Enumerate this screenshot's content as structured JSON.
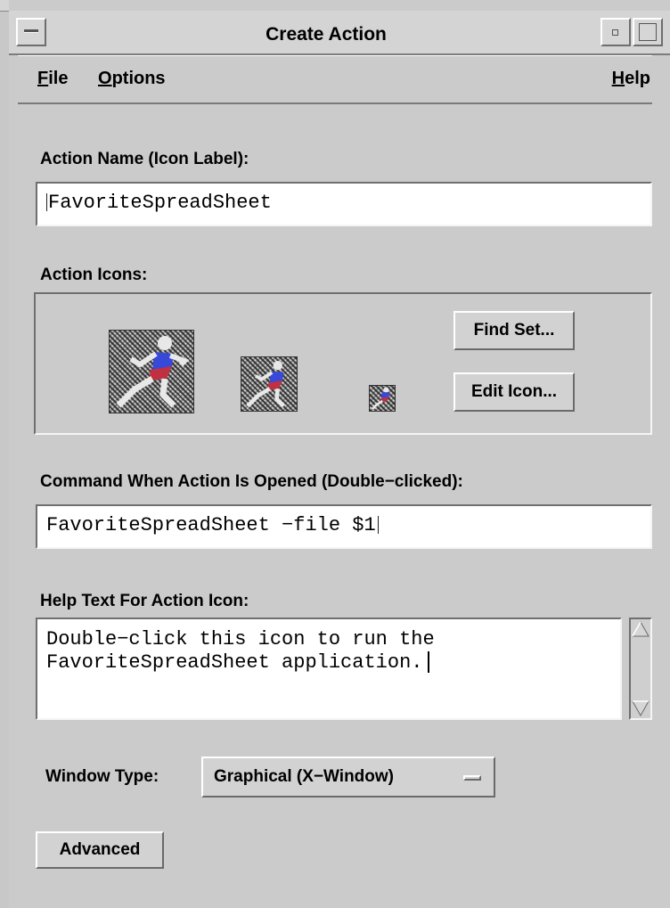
{
  "window": {
    "title": "Create Action"
  },
  "menubar": {
    "file": {
      "mnemonic": "F",
      "rest": "ile"
    },
    "options": {
      "mnemonic": "O",
      "rest": "ptions"
    },
    "help": {
      "mnemonic": "H",
      "rest": "elp"
    }
  },
  "action_name": {
    "label": "Action Name (Icon Label):",
    "value": "FavoriteSpreadSheet"
  },
  "action_icons": {
    "label": "Action Icons:",
    "find_set_button": "Find Set...",
    "edit_icon_button": "Edit Icon..."
  },
  "command": {
    "label": "Command When Action Is Opened (Double−clicked):",
    "value": "FavoriteSpreadSheet −file $1"
  },
  "help_text": {
    "label": "Help Text For Action Icon:",
    "line1": "Double−click this icon to run the",
    "line2": "FavoriteSpreadSheet application."
  },
  "window_type": {
    "label": "Window Type:",
    "selected": "Graphical (X−Window)"
  },
  "advanced_button": "Advanced",
  "colors": {
    "runner_shirt": "#3848d8",
    "runner_shorts": "#c03040",
    "runner_skin": "#e8e8e8"
  },
  "icons": [
    "window-menu-icon",
    "minimize-icon",
    "maximize-icon",
    "runner-icon-large",
    "runner-icon-medium",
    "runner-icon-small",
    "option-menu-indicator-icon",
    "scroll-up-arrow-icon",
    "scroll-down-arrow-icon"
  ]
}
